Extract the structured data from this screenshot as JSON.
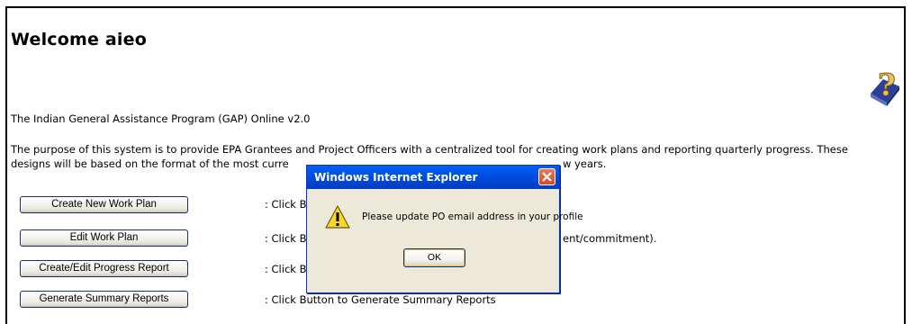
{
  "header": {
    "welcome": "Welcome aieo"
  },
  "icons": {
    "help": "help-book-icon",
    "warning": "warning-icon",
    "close": "close-icon"
  },
  "intro": {
    "version_line": "The Indian General Assistance Program (GAP) Online v2.0",
    "purpose_line1": "The purpose of this system is to provide EPA Grantees and Project Officers with a centralized tool for creating work plans and reporting quarterly progress. These",
    "purpose_line2_start": "designs will be based on the format of the most curre",
    "purpose_line2_end": "w years."
  },
  "actions": [
    {
      "label": "Create New Work Plan",
      "desc": ": Click B",
      "desc_tail": ""
    },
    {
      "label": "Edit Work Plan",
      "desc": ": Click B",
      "desc_tail": "ent/commitment)."
    },
    {
      "label": "Create/Edit Progress Report",
      "desc": ": Click B",
      "desc_tail": ""
    },
    {
      "label": "Generate Summary Reports",
      "desc": ": Click Button to Generate Summary Reports",
      "desc_tail": ""
    }
  ],
  "dialog": {
    "title": "Windows Internet Explorer",
    "message": "Please update PO email address in your profile",
    "ok_label": "OK"
  },
  "colors": {
    "titlebar": "#0054e3",
    "dialog_bg": "#ece9d8",
    "close_button": "#d44a25",
    "button_border": "#1a2f5e"
  }
}
